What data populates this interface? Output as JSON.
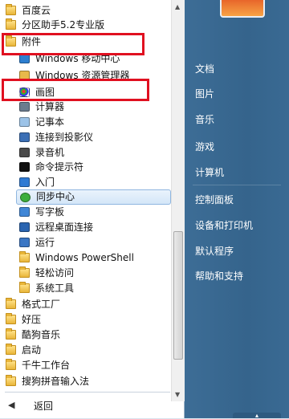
{
  "programs": [
    {
      "label": "百度云",
      "icon": "folder-icon",
      "kind": "folder"
    },
    {
      "label": "分区助手5.2专业版",
      "icon": "folder-icon",
      "kind": "folder"
    },
    {
      "label": "附件",
      "icon": "folder-icon",
      "kind": "folder"
    },
    {
      "label": "Windows 移动中心",
      "icon": "mobility-center-icon",
      "kind": "sub"
    },
    {
      "label": "Windows 资源管理器",
      "icon": "explorer-icon",
      "kind": "sub"
    },
    {
      "label": "画图",
      "icon": "paint-icon",
      "kind": "sub"
    },
    {
      "label": "计算器",
      "icon": "calculator-icon",
      "kind": "sub"
    },
    {
      "label": "记事本",
      "icon": "notepad-icon",
      "kind": "sub"
    },
    {
      "label": "连接到投影仪",
      "icon": "projector-icon",
      "kind": "sub"
    },
    {
      "label": "录音机",
      "icon": "microphone-icon",
      "kind": "sub"
    },
    {
      "label": "命令提示符",
      "icon": "cmd-icon",
      "kind": "sub"
    },
    {
      "label": "入门",
      "icon": "getting-started-icon",
      "kind": "sub"
    },
    {
      "label": "同步中心",
      "icon": "sync-center-icon",
      "kind": "sub"
    },
    {
      "label": "写字板",
      "icon": "wordpad-icon",
      "kind": "sub"
    },
    {
      "label": "远程桌面连接",
      "icon": "remote-desktop-icon",
      "kind": "sub"
    },
    {
      "label": "运行",
      "icon": "run-icon",
      "kind": "sub"
    },
    {
      "label": "Windows PowerShell",
      "icon": "folder-icon",
      "kind": "subfolder"
    },
    {
      "label": "轻松访问",
      "icon": "folder-icon",
      "kind": "subfolder"
    },
    {
      "label": "系统工具",
      "icon": "folder-icon",
      "kind": "subfolder"
    },
    {
      "label": "格式工厂",
      "icon": "folder-icon",
      "kind": "folder"
    },
    {
      "label": "好压",
      "icon": "folder-icon",
      "kind": "folder"
    },
    {
      "label": "酷狗音乐",
      "icon": "folder-icon",
      "kind": "folder"
    },
    {
      "label": "启动",
      "icon": "folder-icon",
      "kind": "folder"
    },
    {
      "label": "千牛工作台",
      "icon": "folder-icon",
      "kind": "folder"
    },
    {
      "label": "搜狗拼音输入法",
      "icon": "folder-icon",
      "kind": "folder"
    }
  ],
  "back_label": "返回",
  "right_menu": [
    "文档",
    "图片",
    "音乐",
    "游戏",
    "计算机",
    "控制面板",
    "设备和打印机",
    "默认程序",
    "帮助和支持"
  ],
  "colors": {
    "highlight_box": "#e01020",
    "right_panel": "#35648c",
    "selection": "#d4e6f8"
  },
  "selected_item": "同步中心"
}
